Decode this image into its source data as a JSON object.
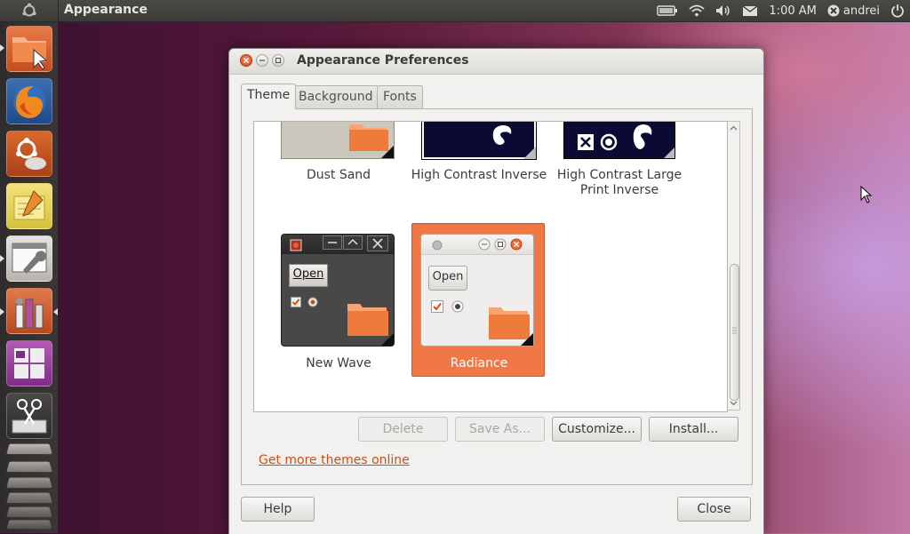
{
  "panel": {
    "app_title": "Appearance",
    "clock": "1:00 AM",
    "user": "andrei",
    "icons": [
      "battery-icon",
      "wifi-icon",
      "volume-icon",
      "mail-icon",
      "user-status-icon",
      "power-icon"
    ]
  },
  "launcher": {
    "items": [
      "home-folder",
      "firefox",
      "ubuntu-one",
      "text-editor",
      "system-settings",
      "system-tools",
      "workspaces",
      "screenshot",
      "more-stack"
    ]
  },
  "window": {
    "title": "Appearance Preferences",
    "tabs": [
      {
        "label": "Theme"
      },
      {
        "label": "Background"
      },
      {
        "label": "Fonts"
      }
    ],
    "themes": [
      {
        "label": "Dust Sand"
      },
      {
        "label": "High Contrast Inverse"
      },
      {
        "label": "High Contrast Large Print Inverse"
      },
      {
        "label": "New Wave",
        "open_label": "Open"
      },
      {
        "label": "Radiance",
        "open_label": "Open",
        "selected": true
      }
    ],
    "buttons": {
      "delete": "Delete",
      "save_as": "Save As...",
      "customize": "Customize...",
      "install": "Install..."
    },
    "more_link": "Get more themes online",
    "help": "Help",
    "close": "Close"
  },
  "colors": {
    "accent": "#f07746",
    "panel": "#3c3b37",
    "link": "#d24e14"
  }
}
